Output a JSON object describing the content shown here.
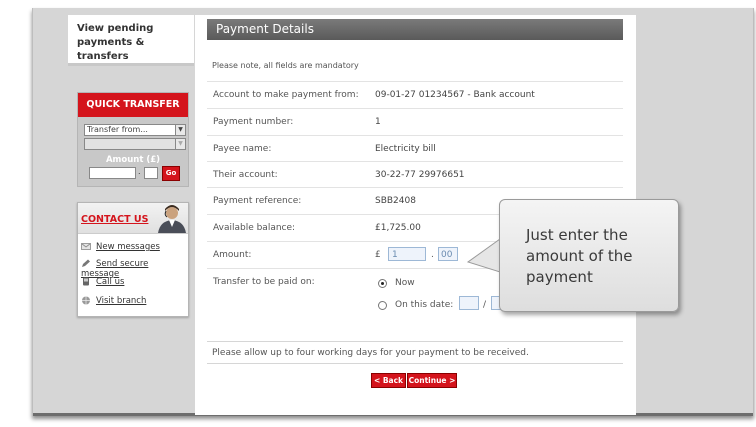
{
  "sidebar": {
    "pending_link": "View pending payments & transfers",
    "quick_transfer": {
      "title": "QUICK TRANSFER",
      "from_selected": "Transfer from...",
      "to_selected": "",
      "amount_label": "Amount (£)",
      "separator": ".",
      "go_label": "Go"
    },
    "contact": {
      "title": "CONTACT US",
      "items": [
        {
          "label": "New messages",
          "icon": "envelope-icon"
        },
        {
          "label": "Send secure message",
          "icon": "pen-icon"
        },
        {
          "label": "Call us",
          "icon": "phone-icon"
        },
        {
          "label": "Visit branch",
          "icon": "globe-icon"
        }
      ]
    }
  },
  "main": {
    "title": "Payment Details",
    "note": "Please note, all fields are mandatory",
    "fields": [
      {
        "label": "Account to make payment from:",
        "value": "09-01-27 01234567 - Bank account"
      },
      {
        "label": "Payment number:",
        "value": "1"
      },
      {
        "label": "Payee name:",
        "value": "Electricity bill"
      },
      {
        "label": "Their account:",
        "value": "30-22-77 29976651"
      },
      {
        "label": "Payment reference:",
        "value": "SBB2408"
      },
      {
        "label": "Available balance:",
        "value": "£1,725.00"
      }
    ],
    "amount": {
      "label": "Amount:",
      "currency": "£",
      "pounds": "1",
      "separator": ".",
      "pence": "00"
    },
    "transfer_date": {
      "label": "Transfer to be paid on:",
      "option_now": "Now",
      "option_date": "On this date:",
      "date_separator": "/"
    },
    "info": "Please allow up to four working days for your payment to be received.",
    "back_label": "< Back",
    "continue_label": "Continue >"
  },
  "callout": {
    "text": "Just enter the amount of the payment"
  },
  "colors": {
    "brand_red": "#d4141c",
    "header_gray": "#666666"
  }
}
